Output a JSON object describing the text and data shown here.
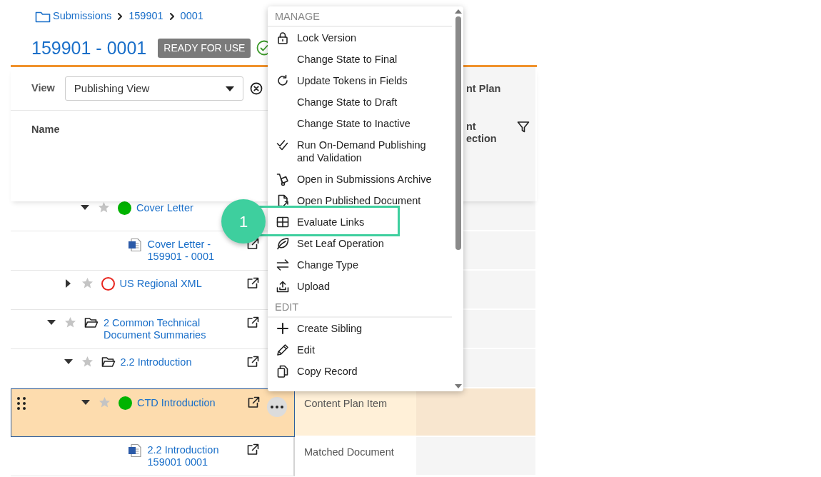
{
  "breadcrumb": [
    {
      "label": "Submissions"
    },
    {
      "label": "159901"
    },
    {
      "label": "0001"
    }
  ],
  "title": "159901 - 0001",
  "status_badge": "READY FOR USE",
  "view": {
    "label": "View",
    "value": "Publishing View"
  },
  "header": {
    "name_column": "Name",
    "group_heading": "nt Plan",
    "column_2": "nt ection"
  },
  "tree": [
    {
      "children": [
        {
          "children": [
            {
              "label": "Cover Letter",
              "kind": "item",
              "color": "#00b300",
              "expanded": true,
              "selected": false,
              "children": [
                {
                  "label": "Cover Letter - 159901 - 0001",
                  "kind": "document",
                  "selected": false
                }
              ]
            }
          ]
        },
        {
          "label": "US Regional XML",
          "kind": "pending",
          "color": "#e8261f",
          "expanded": false,
          "selected": false
        }
      ]
    },
    {
      "label": "2 Common Technical Document Summaries",
      "kind": "folder",
      "expanded": true,
      "selected": false,
      "children": [
        {
          "label": "2.2 Introduction",
          "kind": "folder",
          "expanded": true,
          "selected": false,
          "children": [
            {
              "label": "CTD Introduction",
              "kind": "item",
              "color": "#00b300",
              "expanded": true,
              "selected": true,
              "type": "Content Plan Item",
              "children": [
                {
                  "label": "2.2 Introduction 159001 0001",
                  "kind": "document",
                  "selected": false,
                  "type": "Matched Document"
                }
              ]
            }
          ]
        }
      ]
    }
  ],
  "context_menu": {
    "sections": [
      {
        "heading": "MANAGE",
        "items": [
          {
            "label": "Lock Version",
            "highlighted": false
          },
          {
            "label": "Change State to Final",
            "highlighted": false
          },
          {
            "label": "Update Tokens in Fields",
            "highlighted": false
          },
          {
            "label": "Change State to Draft",
            "highlighted": false
          },
          {
            "label": "Change State to Inactive",
            "highlighted": false
          },
          {
            "label": "Run On-Demand Publishing and Validation",
            "highlighted": false
          },
          {
            "label": "Open in Submissions Archive",
            "highlighted": false
          },
          {
            "label": "Open Published Document",
            "highlighted": false
          },
          {
            "label": "Evaluate Links",
            "highlighted": true
          },
          {
            "label": "Set Leaf Operation",
            "highlighted": false
          },
          {
            "label": "Change Type",
            "highlighted": false
          },
          {
            "label": "Upload",
            "highlighted": false
          }
        ]
      },
      {
        "heading": "EDIT",
        "items": [
          {
            "label": "Create Sibling",
            "highlighted": false
          },
          {
            "label": "Edit",
            "highlighted": false
          },
          {
            "label": "Copy Record",
            "highlighted": false
          }
        ]
      }
    ]
  },
  "callout": {
    "number": "1"
  }
}
